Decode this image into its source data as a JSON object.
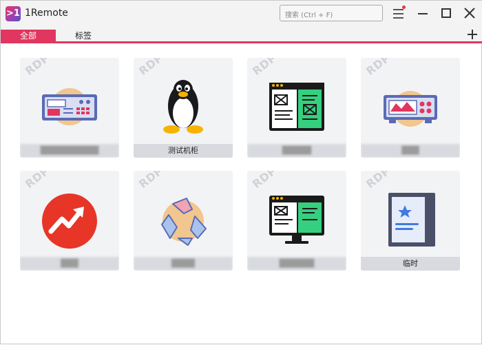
{
  "app": {
    "title": "1Remote",
    "logo_text": ">1"
  },
  "search": {
    "placeholder": "搜索 (Ctrl + F)"
  },
  "tabs": [
    {
      "label": "全部",
      "active": true
    },
    {
      "label": "标签",
      "active": false
    }
  ],
  "colors": {
    "accent": "#e0365f",
    "card_bg": "#f2f3f5",
    "card_label_bg": "#d8dadf"
  },
  "servers": [
    {
      "protocol": "RDP",
      "name": "██████████",
      "name_blurred": true,
      "icon": "control-panel-icon"
    },
    {
      "protocol": "RDP",
      "name": "测试机柜",
      "name_blurred": false,
      "icon": "linux-penguin-icon"
    },
    {
      "protocol": "RDP",
      "name": "█████",
      "name_blurred": true,
      "icon": "code-editor-icon"
    },
    {
      "protocol": "RDP",
      "name": "███",
      "name_blurred": true,
      "icon": "oscilloscope-icon"
    },
    {
      "protocol": "RDP",
      "name": "███",
      "name_blurred": true,
      "icon": "trend-arrow-icon"
    },
    {
      "protocol": "RDP",
      "name": "████",
      "name_blurred": true,
      "icon": "recycle-icon"
    },
    {
      "protocol": "RDP",
      "name": "██████",
      "name_blurred": true,
      "icon": "monitor-code-icon"
    },
    {
      "protocol": "RDP",
      "name": "临时",
      "name_blurred": false,
      "icon": "tablet-star-icon"
    }
  ]
}
